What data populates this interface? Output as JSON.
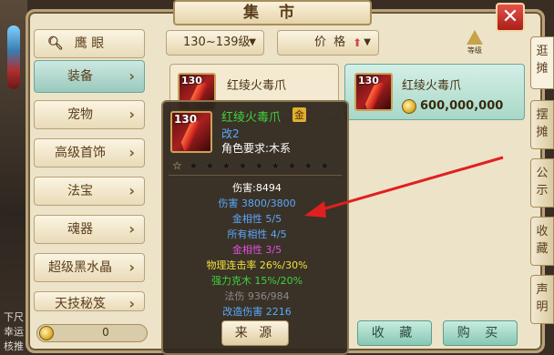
{
  "window": {
    "title": "集 市",
    "close_label": "✕"
  },
  "left_strip": {
    "texts": [
      "下尺",
      "幸运",
      "核推"
    ]
  },
  "sidebar": {
    "search_label": "鹰 眼",
    "items": [
      {
        "label": "装备",
        "active": true
      },
      {
        "label": "宠物",
        "active": false
      },
      {
        "label": "高级首饰",
        "active": false
      },
      {
        "label": "法宝",
        "active": false
      },
      {
        "label": "魂器",
        "active": false
      },
      {
        "label": "超级黑水晶",
        "active": false
      },
      {
        "label": "天技秘笈",
        "active": false
      }
    ],
    "currency_value": "0"
  },
  "filters": {
    "level_range": "130~139级",
    "price_sort": "价 格",
    "level_corner": "等级"
  },
  "right_tabs": [
    {
      "label": "逛摊",
      "active": true
    },
    {
      "label": "摆摊",
      "active": false
    },
    {
      "label": "公示",
      "active": false
    },
    {
      "label": "收藏",
      "active": false
    },
    {
      "label": "声明",
      "active": false
    }
  ],
  "items": [
    {
      "level": "130",
      "name": "红绫火毒爪",
      "price": ""
    },
    {
      "level": "130",
      "name": "红绫火毒爪",
      "price": "600,000,000"
    }
  ],
  "tooltip": {
    "level": "130",
    "name": "红绫火毒爪",
    "badge": "金",
    "sub": "改2",
    "requirement": "角色要求:木系",
    "stars_total": 10,
    "stats": [
      {
        "text": "伤害:8494",
        "color": "#ffffff"
      },
      {
        "text": "伤害 3800/3800",
        "color": "#5aa8ff"
      },
      {
        "text": "金相性 5/5",
        "color": "#5aa8ff"
      },
      {
        "text": "所有相性 4/5",
        "color": "#5aa8ff"
      },
      {
        "text": "金相性 3/5",
        "color": "#e050e0"
      },
      {
        "text": "物理连击率 26%/30%",
        "color": "#f0e040"
      },
      {
        "text": "强力克木 15%/20%",
        "color": "#40d040"
      },
      {
        "text": "法伤 936/984",
        "color": "#8a8a8a"
      },
      {
        "text": "改造伤害 2216",
        "color": "#5aa8ff"
      }
    ],
    "source_button": "来 源"
  },
  "actions": {
    "favorite": "收 藏",
    "buy": "购 买"
  }
}
